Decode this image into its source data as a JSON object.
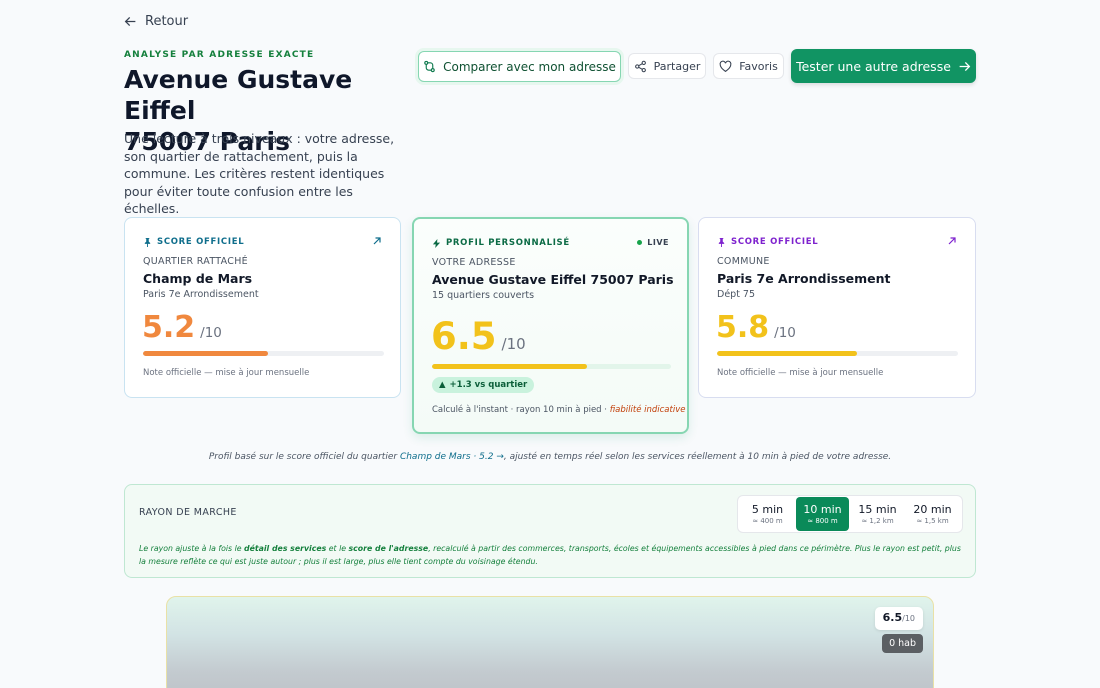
{
  "nav": {
    "back_label": "Retour"
  },
  "header": {
    "eyebrow": "ANALYSE PAR ADRESSE EXACTE",
    "title_line1": "Avenue Gustave Eiffel",
    "title_line2": "75007 Paris",
    "lead": "Une lecture à trois niveaux : votre adresse, son quartier de rattachement, puis la commune. Les critères restent identiques pour éviter toute confusion entre les échelles."
  },
  "actions": {
    "compare": "Comparer avec mon adresse",
    "share": "Partager",
    "favorites": "Favoris",
    "test_other": "Tester une autre adresse"
  },
  "cards": {
    "quartier": {
      "tag": "SCORE OFFICIEL",
      "scope": "QUARTIER RATTACHÉ",
      "name": "Champ de Mars",
      "sub": "Paris 7e Arrondissement",
      "score": "5.2",
      "out_of": "/10",
      "score_fraction": 0.52,
      "note": "Note officielle — mise à jour mensuelle",
      "color": "#f0883e"
    },
    "adresse": {
      "tag": "PROFIL PERSONNALISÉ",
      "live": "LIVE",
      "scope": "VOTRE ADRESSE",
      "name": "Avenue Gustave Eiffel 75007 Paris",
      "sub": "15 quartiers couverts",
      "score": "6.5",
      "out_of": "/10",
      "score_fraction": 0.65,
      "delta": "+1.3 vs quartier",
      "calc": "Calculé à l'instant · rayon 10 min à pied · ",
      "reliability": "fiabilité indicative",
      "color": "#f2c21b"
    },
    "commune": {
      "tag": "SCORE OFFICIEL",
      "scope": "COMMUNE",
      "name": "Paris 7e Arrondissement",
      "sub": "Dépt 75",
      "score": "5.8",
      "out_of": "/10",
      "score_fraction": 0.58,
      "note": "Note officielle — mise à jour mensuelle",
      "color": "#f2c21b"
    }
  },
  "profile_note": {
    "before": "Profil basé sur le score officiel du quartier ",
    "link": "Champ de Mars · 5.2 →",
    "after": ", ajusté en temps réel selon les services réellement à 10 min à pied de votre adresse."
  },
  "radius": {
    "label": "RAYON DE MARCHE",
    "options": [
      {
        "label": "5 min",
        "dist": "≈ 400 m"
      },
      {
        "label": "10 min",
        "dist": "≈ 800 m"
      },
      {
        "label": "15 min",
        "dist": "≈ 1,2 km"
      },
      {
        "label": "20 min",
        "dist": "≈ 1,5 km"
      }
    ],
    "selected": "10 min",
    "desc_1": "Le rayon ajuste à la fois le ",
    "desc_b1": "détail des services",
    "desc_2": " et le ",
    "desc_b2": "score de l'adresse",
    "desc_3": ", recalculé à partir des commerces, transports, écoles et équipements accessibles à pied dans ce périmètre. Plus le rayon est petit, plus la mesure reflète ce qui est juste autour ; plus il est large, plus elle tient compte du voisinage étendu."
  },
  "map": {
    "score": "6.5",
    "out_of": "/10",
    "population": "0 hab"
  }
}
